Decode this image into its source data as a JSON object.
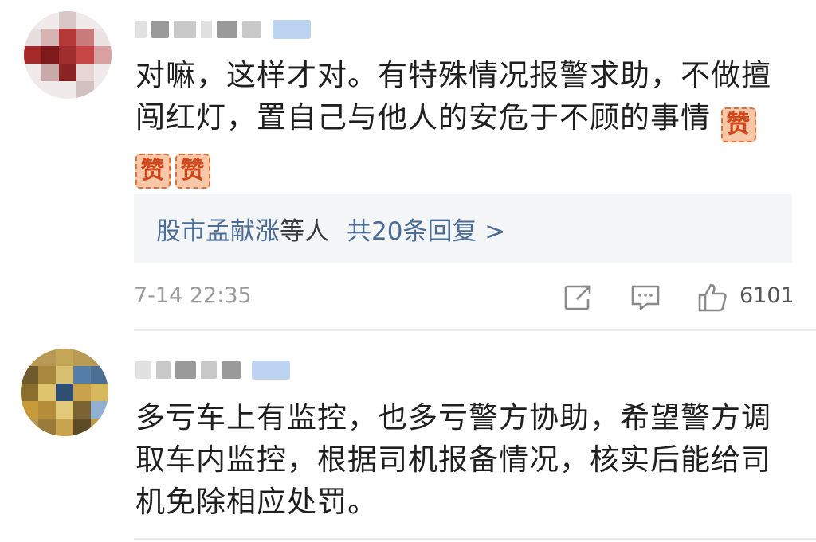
{
  "comments": [
    {
      "text_line1": "对嘛，这样才对。有特殊情况报警求助，不做擅",
      "text_line2": "闯红灯，置自己与他人的安危于不顾的事情",
      "emoji_label": "赞",
      "replies": {
        "names": "股市孟献涨",
        "others": "等人",
        "count": "共20条回复 >"
      },
      "timestamp": "7-14 22:35",
      "likes": "6101",
      "colors": {
        "reply_link": "#4a6c96",
        "emoji_bg": "#f6c8a8",
        "emoji_fg": "#d2481c"
      }
    },
    {
      "text_line1": "多亏车上有监控，也多亏警方协助，希望警方调",
      "text_line2": "取车内监控，根据司机报备情况，核实后能给司",
      "text_line3": "机免除相应处罚。"
    }
  ],
  "icons": [
    "share-icon",
    "comment-icon",
    "like-icon"
  ]
}
